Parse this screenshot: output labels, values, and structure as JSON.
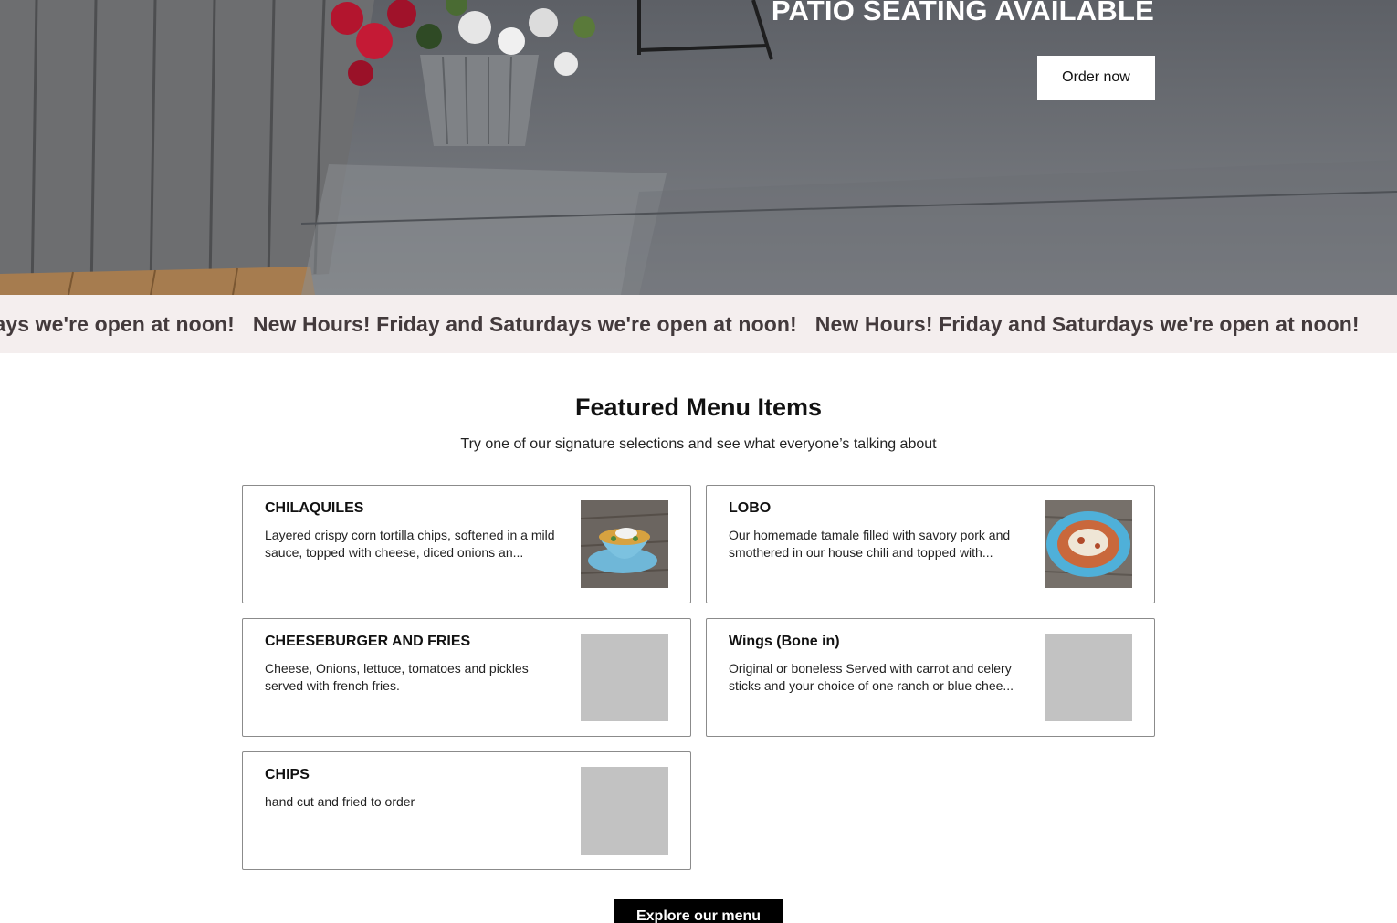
{
  "hero": {
    "title": "PATIO SEATING AVAILABLE",
    "order_button": "Order now"
  },
  "marquee": {
    "items": [
      "New Hours! Friday and Saturdays we're open at noon!",
      "New Hours! Friday and Saturdays we're open at noon!",
      "New Hours! Friday and Saturdays we're open at noon!"
    ]
  },
  "featured": {
    "title": "Featured Menu Items",
    "subtitle": "Try one of our signature selections and see what everyone’s talking about",
    "items": [
      {
        "name": "CHILAQUILES",
        "description": "Layered crispy corn tortilla chips, softened in a mild sauce, topped with cheese, diced onions an..."
      },
      {
        "name": "LOBO",
        "description": "Our homemade tamale filled with savory pork and smothered in our house chili and topped with..."
      },
      {
        "name": "CHEESEBURGER AND FRIES",
        "description": "Cheese, Onions, lettuce, tomatoes and pickles served with french fries."
      },
      {
        "name": "Wings (Bone in)",
        "description": "Original or boneless Served with carrot and celery sticks and your choice of one ranch or blue chee..."
      },
      {
        "name": "CHIPS",
        "description": "hand cut and fried to order"
      }
    ],
    "explore_button": "Explore our menu"
  }
}
